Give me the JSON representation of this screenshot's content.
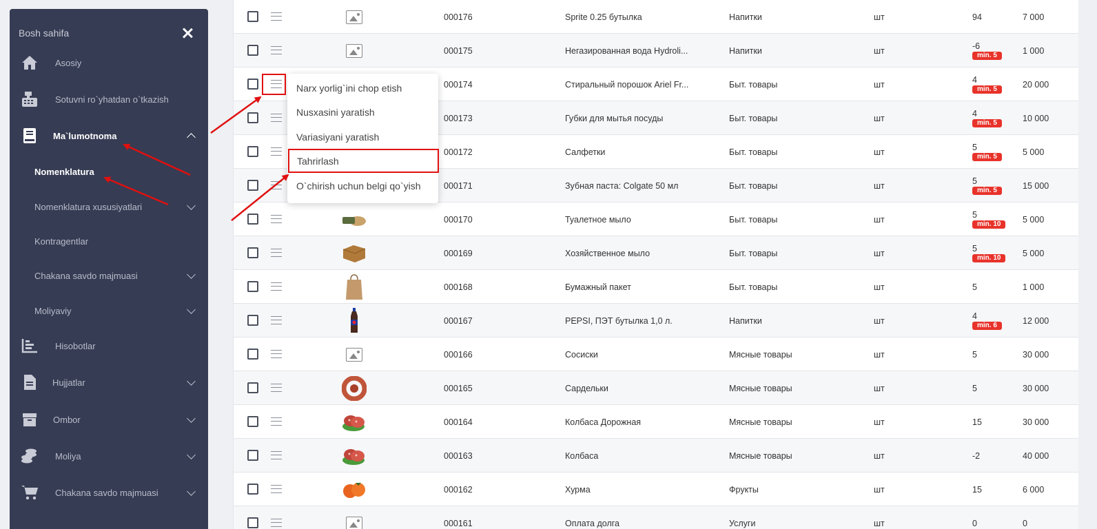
{
  "sidebar": {
    "title": "Bosh sahifa",
    "items": [
      {
        "label": "Asosiy",
        "icon": "home-icon"
      },
      {
        "label": "Sotuvni ro`yhatdan o`tkazish",
        "icon": "cash-register-icon"
      },
      {
        "label": "Ma`lumotnoma",
        "icon": "book-icon"
      },
      {
        "label": "Nomenklatura"
      },
      {
        "label": "Nomenklatura xususiyatlari"
      },
      {
        "label": "Kontragentlar"
      },
      {
        "label": "Chakana savdo majmuasi"
      },
      {
        "label": "Moliyaviy"
      },
      {
        "label": "Hisobotlar",
        "icon": "chart-icon"
      },
      {
        "label": "Hujjatlar",
        "icon": "document-icon"
      },
      {
        "label": "Ombor",
        "icon": "box-icon"
      },
      {
        "label": "Moliya",
        "icon": "coins-icon"
      },
      {
        "label": "Chakana savdo majmuasi",
        "icon": "cart-icon"
      }
    ]
  },
  "context_menu": {
    "items": [
      "Narx yorlig`ini chop etish",
      "Nusxasini yaratish",
      "Variasiyani yaratish",
      "Tahrirlash",
      "O`chirish uchun belgi qo`yish"
    ],
    "highlighted": "Tahrirlash"
  },
  "products": [
    {
      "code": "000176",
      "name": "Sprite 0.25 бутылка",
      "category": "Напитки",
      "unit": "шт",
      "qty": "94",
      "min": "",
      "price": "7 000",
      "img": "placeholder"
    },
    {
      "code": "000175",
      "name": "Негазированная вода Hydroli...",
      "category": "Напитки",
      "unit": "шт",
      "qty": "-6",
      "min": "min. 5",
      "price": "1 000",
      "img": "placeholder"
    },
    {
      "code": "000174",
      "name": "Стиральный порошок Ariel Fr...",
      "category": "Быт. товары",
      "unit": "шт",
      "qty": "4",
      "min": "min. 5",
      "price": "20 000",
      "img": "none"
    },
    {
      "code": "000173",
      "name": "Губки для мытья посуды",
      "category": "Быт. товары",
      "unit": "шт",
      "qty": "4",
      "min": "min. 5",
      "price": "10 000",
      "img": "none"
    },
    {
      "code": "000172",
      "name": "Салфетки",
      "category": "Быт. товары",
      "unit": "шт",
      "qty": "5",
      "min": "min. 5",
      "price": "5 000",
      "img": "none"
    },
    {
      "code": "000171",
      "name": "Зубная паста: Colgate 50 мл",
      "category": "Быт. товары",
      "unit": "шт",
      "qty": "5",
      "min": "min. 5",
      "price": "15 000",
      "img": "none"
    },
    {
      "code": "000170",
      "name": "Туалетное мыло",
      "category": "Быт. товары",
      "unit": "шт",
      "qty": "5",
      "min": "min. 10",
      "price": "5 000",
      "img": "soap"
    },
    {
      "code": "000169",
      "name": "Хозяйственное мыло",
      "category": "Быт. товары",
      "unit": "шт",
      "qty": "5",
      "min": "min. 10",
      "price": "5 000",
      "img": "bar-soap"
    },
    {
      "code": "000168",
      "name": "Бумажный пакет",
      "category": "Быт. товары",
      "unit": "шт",
      "qty": "5",
      "min": "",
      "price": "1 000",
      "img": "paper-bag"
    },
    {
      "code": "000167",
      "name": "PEPSI, ПЭТ бутылка 1,0 л.",
      "category": "Напитки",
      "unit": "шт",
      "qty": "4",
      "min": "min. 6",
      "price": "12 000",
      "img": "bottle"
    },
    {
      "code": "000166",
      "name": "Сосиски",
      "category": "Мясные товары",
      "unit": "шт",
      "qty": "5",
      "min": "",
      "price": "30 000",
      "img": "placeholder"
    },
    {
      "code": "000165",
      "name": "Сардельки",
      "category": "Мясные товары",
      "unit": "шт",
      "qty": "5",
      "min": "",
      "price": "30 000",
      "img": "sausage"
    },
    {
      "code": "000164",
      "name": "Колбаса Дорожная",
      "category": "Мясные товары",
      "unit": "шт",
      "qty": "15",
      "min": "",
      "price": "30 000",
      "img": "salami"
    },
    {
      "code": "000163",
      "name": "Колбаса",
      "category": "Мясные товары",
      "unit": "шт",
      "qty": "-2",
      "min": "",
      "price": "40 000",
      "img": "salami"
    },
    {
      "code": "000162",
      "name": "Хурма",
      "category": "Фрукты",
      "unit": "шт",
      "qty": "15",
      "min": "",
      "price": "6 000",
      "img": "persimmon"
    },
    {
      "code": "000161",
      "name": "Оплата долга",
      "category": "Услуги",
      "unit": "шт",
      "qty": "0",
      "min": "",
      "price": "0",
      "img": "placeholder"
    }
  ],
  "colors": {
    "sidebar_bg": "#363c53",
    "badge": "#e8332b",
    "annotation": "#e01010"
  }
}
